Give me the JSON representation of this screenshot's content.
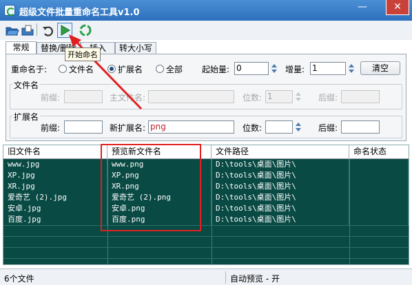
{
  "window": {
    "title": "超级文件批量重命名工具v1.0",
    "minimize": "—",
    "close": "✕"
  },
  "toolbar": {
    "tooltip": "开始命名"
  },
  "tabs": [
    "常规",
    "替换/删除",
    "插入",
    "转大小写"
  ],
  "rename": {
    "label": "重命名于:",
    "options": [
      "文件名",
      "扩展名",
      "全部"
    ],
    "selected": "扩展名",
    "start_label": "起始量:",
    "start_value": "0",
    "step_label": "增量:",
    "step_value": "1",
    "clear": "清空"
  },
  "filename_group": {
    "title": "文件名",
    "prefix_label": "前缀:",
    "main_label": "主文件名:",
    "digits_label": "位数:",
    "digits_value": "1",
    "suffix_label": "后缀:"
  },
  "ext_group": {
    "title": "扩展名",
    "prefix_label": "前缀:",
    "new_ext_label": "新扩展名:",
    "new_ext_value": "png",
    "digits_label": "位数:",
    "suffix_label": "后缀:"
  },
  "grid": {
    "columns": [
      "旧文件名",
      "预览新文件名",
      "文件路径",
      "命名状态"
    ],
    "rows": [
      [
        "www.jpg",
        "www.png",
        "D:\\tools\\桌面\\图片\\",
        ""
      ],
      [
        "XP.jpg",
        "XP.png",
        "D:\\tools\\桌面\\图片\\",
        ""
      ],
      [
        "XR.jpg",
        "XR.png",
        "D:\\tools\\桌面\\图片\\",
        ""
      ],
      [
        "爱奇艺 (2).jpg",
        "爱奇艺 (2).png",
        "D:\\tools\\桌面\\图片\\",
        ""
      ],
      [
        "安卓.jpg",
        "安卓.png",
        "D:\\tools\\桌面\\图片\\",
        ""
      ],
      [
        "百度.jpg",
        "百度.png",
        "D:\\tools\\桌面\\图片\\",
        ""
      ]
    ]
  },
  "status": {
    "count": "6个文件",
    "preview": "自动预览 - 开"
  },
  "colors": {
    "grid_bg": "#0a4a44",
    "title_bar": "#2d6fbd",
    "annotation": "#e02020"
  }
}
